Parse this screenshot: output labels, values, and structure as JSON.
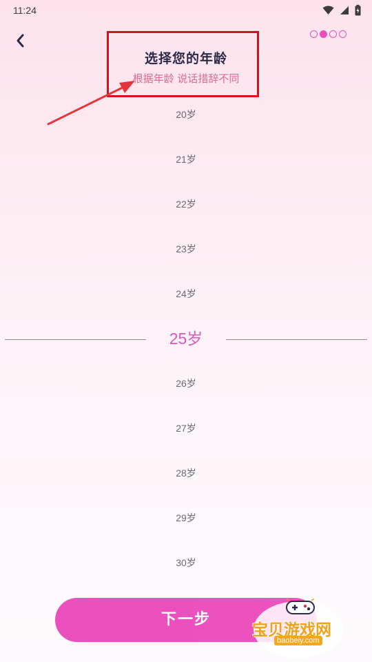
{
  "status_bar": {
    "time": "11:24",
    "icons": [
      "wifi-icon",
      "cell-signal-icon",
      "battery-icon"
    ]
  },
  "nav": {
    "back_icon": "chevron-left-icon",
    "progress": {
      "total": 4,
      "current": 2
    }
  },
  "header": {
    "title": "选择您的年龄",
    "subtitle": "根据年龄 说话措辞不同"
  },
  "age_picker": {
    "items": [
      "20岁",
      "21岁",
      "22岁",
      "23岁",
      "24岁",
      "25岁",
      "26岁",
      "27岁",
      "28岁",
      "29岁",
      "30岁"
    ],
    "selected": "25岁"
  },
  "footer": {
    "next_label": "下一步"
  },
  "watermark": {
    "name": "宝贝游戏网",
    "url": "baobeiy.com"
  },
  "colors": {
    "accent": "#e54fbe",
    "selected_text": "#d95abd",
    "subtitle": "#e06a8a",
    "title": "#2c2a4a",
    "annotation": "#d8101a"
  }
}
